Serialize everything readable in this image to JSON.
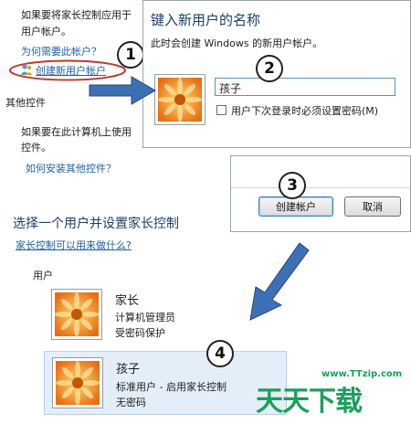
{
  "left_panel": {
    "intro_text_line1": "如果要将家长控制应用于",
    "intro_text_line2": "用户帐户。",
    "why_link": "为何需要此帐户？",
    "create_link": "创建新用户帐户",
    "other_controls_heading": "其他控件",
    "other_text_line1": "如果要在此计算机上使用",
    "other_text_line2": "控件。",
    "install_link": "如何安装其他控件？"
  },
  "name_dialog": {
    "title": "键入新用户的名称",
    "subtitle": "此时会创建 Windows 的新用户帐户。",
    "name_value": "孩子",
    "checkbox_label": "用户下次登录时必须设置密码(M)",
    "checkbox_checked": false
  },
  "button_dialog": {
    "create_button": "创建帐户",
    "cancel_button": "取消"
  },
  "select_section": {
    "heading": "选择一个用户并设置家长控制",
    "help_link": "家长控制可以用来做什么?",
    "users_label": "用户"
  },
  "users": [
    {
      "name": "家长",
      "role": "计算机管理员",
      "status": "受密码保护"
    },
    {
      "name": "孩子",
      "role": "标准用户 - 启用家长控制",
      "status": "无密码"
    }
  ],
  "steps": [
    "1",
    "2",
    "3",
    "4"
  ],
  "watermark": {
    "url": "www.TTzip.com",
    "logo_text": "天天下载"
  },
  "colors": {
    "link": "#1f5fa8",
    "arrow_blue": "#3d6fb4",
    "oval_red": "#c0392b",
    "watermark_green": "#1aa05a",
    "selection_bg": "#e4eef9"
  }
}
